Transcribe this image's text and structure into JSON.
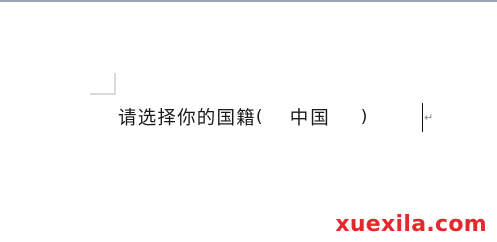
{
  "document": {
    "prompt_text": "请选择你的国籍",
    "paren_open": "(",
    "field_value": "中国",
    "paren_close": ")",
    "paragraph_mark": "↵"
  },
  "watermark": {
    "text": "xuexila.com",
    "color": "#e8272c"
  },
  "icons": {
    "margin_corner": "margin-corner-mark"
  }
}
